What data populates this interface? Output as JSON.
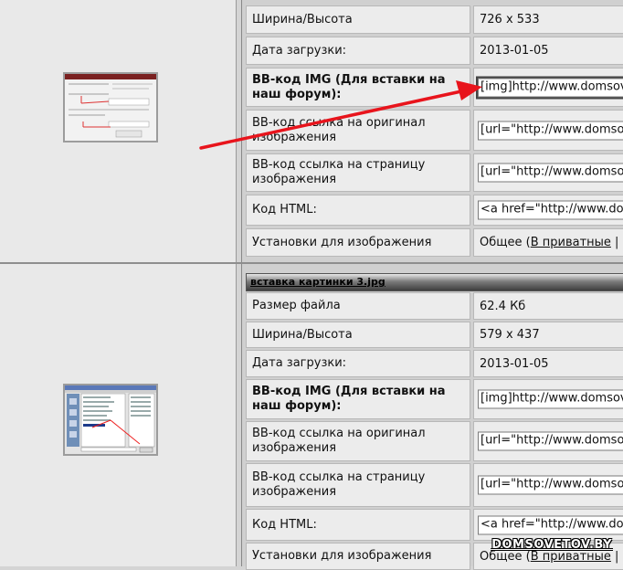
{
  "block1": {
    "rows": [
      {
        "label": "Ширина/Высота",
        "value": "726 x 533"
      },
      {
        "label": "Дата загрузки:",
        "value": "2013-01-05"
      },
      {
        "label": "BB-код IMG (Для вставки на наш форум):",
        "value": "[img]http://www.domsovetov"
      },
      {
        "label": "BB-код ссылка на оригинал изображения",
        "value": "[url=\"http://www.domsovetov"
      },
      {
        "label": "BB-код ссылка на страницу изображения",
        "value": "[url=\"http://www.domsovetov"
      },
      {
        "label": "Код HTML:",
        "value": "<a href=\"http://www.domsovetov"
      },
      {
        "label": "Установки для изображения",
        "value_prefix": "Общее (",
        "value_link": "В приватные",
        "value_suffix": " |"
      }
    ]
  },
  "block2": {
    "title": "вставка картинки 3.jpg",
    "rows": [
      {
        "label": "Размер файла",
        "value": "62.4 Кб"
      },
      {
        "label": "Ширина/Высота",
        "value": "579 x 437"
      },
      {
        "label": "Дата загрузки:",
        "value": "2013-01-05"
      },
      {
        "label": "BB-код IMG (Для вставки на наш форум):",
        "value": "[img]http://www.domsovetov"
      },
      {
        "label": "BB-код ссылка на оригинал изображения",
        "value": "[url=\"http://www.domsovetov"
      },
      {
        "label": "BB-код ссылка на страницу изображения",
        "value": "[url=\"http://www.domsovetov"
      },
      {
        "label": "Код HTML:",
        "value": "<a href=\"http://www.domsovetov"
      },
      {
        "label": "Установки для изображения",
        "value_prefix": "Общее (",
        "value_link": "В приватные",
        "value_suffix": " |"
      }
    ]
  },
  "watermark": "DOMSOVETOV.BY",
  "colors": {
    "annotation_arrow": "#e8141c",
    "panel_bg": "#d0d0d0",
    "cell_bg": "#ececec"
  }
}
